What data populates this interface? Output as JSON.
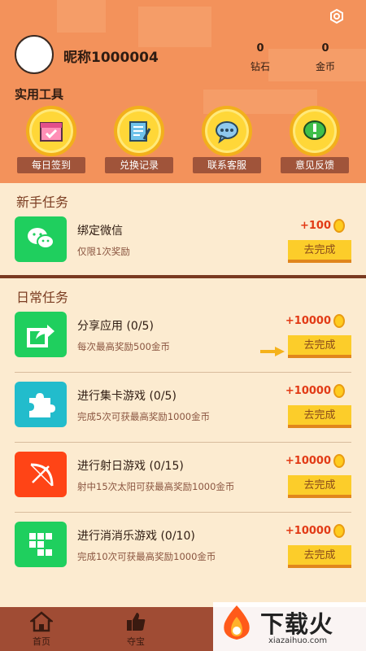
{
  "header": {
    "nickname": "昵称1000004",
    "diamond_value": "0",
    "diamond_label": "钻石",
    "gold_value": "0",
    "gold_label": "金币"
  },
  "tools": {
    "title": "实用工具",
    "items": [
      {
        "label": "每日签到",
        "icon": "calendar-icon"
      },
      {
        "label": "兑换记录",
        "icon": "scroll-icon"
      },
      {
        "label": "联系客服",
        "icon": "chat-bubble-icon"
      },
      {
        "label": "意见反馈",
        "icon": "exclamation-icon"
      }
    ]
  },
  "newbie": {
    "title": "新手任务",
    "tasks": [
      {
        "name": "绑定微信",
        "desc": "仅限1次奖励",
        "reward": "+100",
        "button": "去完成",
        "icon": "wechat-icon",
        "color": "#1fcf5e"
      }
    ]
  },
  "daily": {
    "title": "日常任务",
    "tasks": [
      {
        "name": "分享应用 (0/5)",
        "desc": "每次最高奖励500金币",
        "reward": "+10000",
        "button": "去完成",
        "icon": "share-icon",
        "color": "#1fcf5e"
      },
      {
        "name": "进行集卡游戏 (0/5)",
        "desc": "完成5次可获最高奖励1000金币",
        "reward": "+10000",
        "button": "去完成",
        "icon": "puzzle-icon",
        "color": "#22bccc"
      },
      {
        "name": "进行射日游戏 (0/15)",
        "desc": "射中15次太阳可获最高奖励1000金币",
        "reward": "+10000",
        "button": "去完成",
        "icon": "bow-arrow-icon",
        "color": "#ff4416"
      },
      {
        "name": "进行消消乐游戏 (0/10)",
        "desc": "完成10次可获最高奖励1000金币",
        "reward": "+10000",
        "button": "去完成",
        "icon": "blocks-icon",
        "color": "#1fcf5e"
      }
    ]
  },
  "tabbar": {
    "items": [
      {
        "label": "首页",
        "icon": "home-icon"
      },
      {
        "label": "夺宝",
        "icon": "thumbs-up-icon"
      }
    ]
  },
  "watermark": {
    "text": "下载火",
    "url": "xiazaihuo.com"
  },
  "colors": {
    "header_bg": "#f3925b",
    "page_bg": "#fbecd0",
    "accent_red": "#e23a15",
    "button_yellow": "#fccd2a",
    "tabbar_bg": "#a04c34"
  }
}
